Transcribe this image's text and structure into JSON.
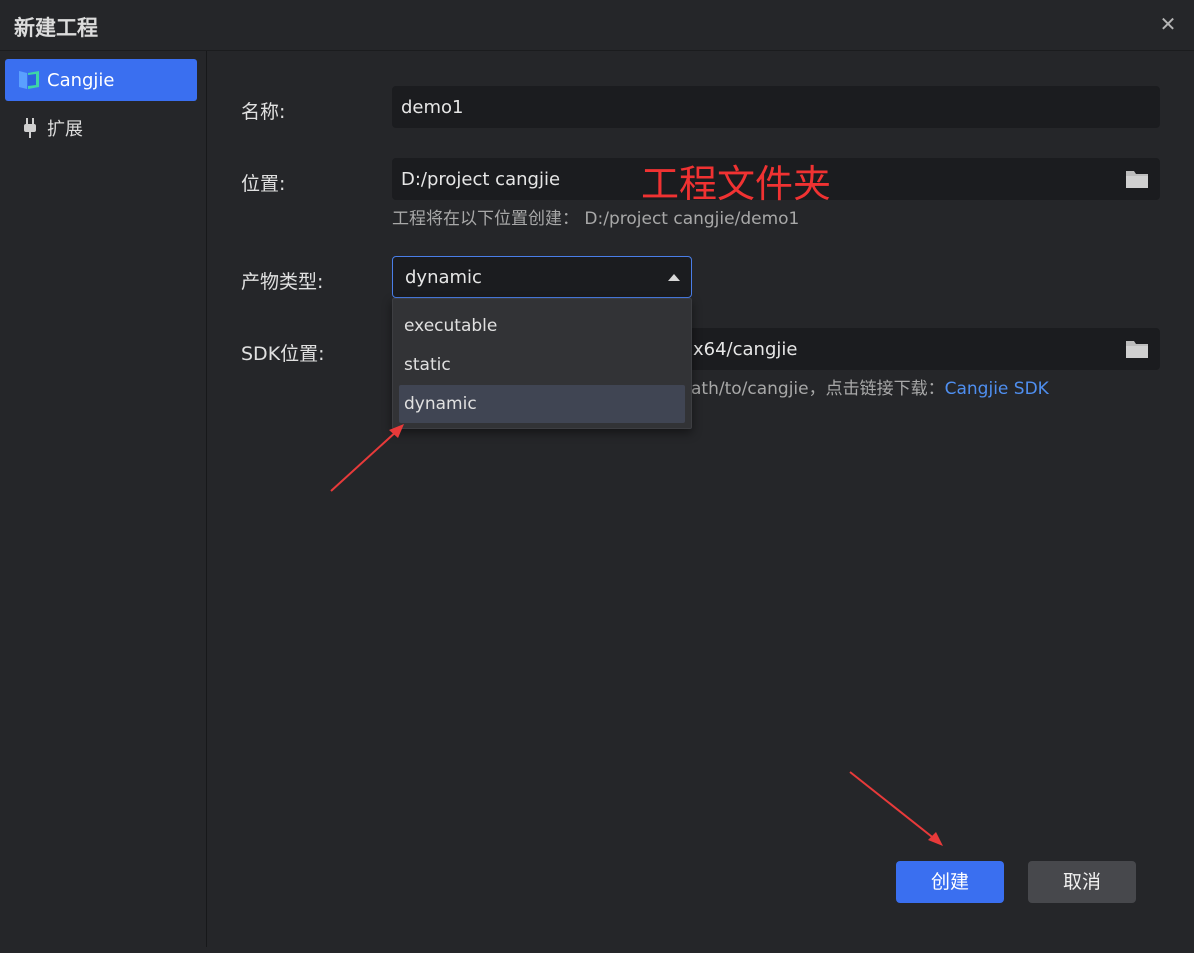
{
  "window": {
    "title": "新建工程",
    "close_icon": "close-icon"
  },
  "sidebar": {
    "items": [
      {
        "label": "Cangjie",
        "icon": "cangjie-logo-icon",
        "active": true
      },
      {
        "label": "扩展",
        "icon": "plug-icon",
        "active": false
      }
    ]
  },
  "form": {
    "name": {
      "label": "名称:",
      "value": "demo1"
    },
    "location": {
      "label": "位置:",
      "value": "D:/project cangjie",
      "hint": "工程将在以下位置创建：  D:/project cangjie/demo1"
    },
    "artifact_type": {
      "label": "产物类型:",
      "value": "dynamic",
      "options": [
        "executable",
        "static",
        "dynamic"
      ]
    },
    "sdk": {
      "label": "SDK位置:",
      "value_visible_part": "x64/cangjie",
      "hint_visible_part": "ath/to/cangjie，点击链接下载：",
      "link_text": "Cangjie SDK"
    }
  },
  "annotation": {
    "text": "工程文件夹",
    "color": "#f03232"
  },
  "buttons": {
    "create": "创建",
    "cancel": "取消"
  },
  "colors": {
    "accent": "#3a6ff0",
    "background": "#252629",
    "field": "#1b1c1f",
    "link": "#4f8ff0"
  }
}
